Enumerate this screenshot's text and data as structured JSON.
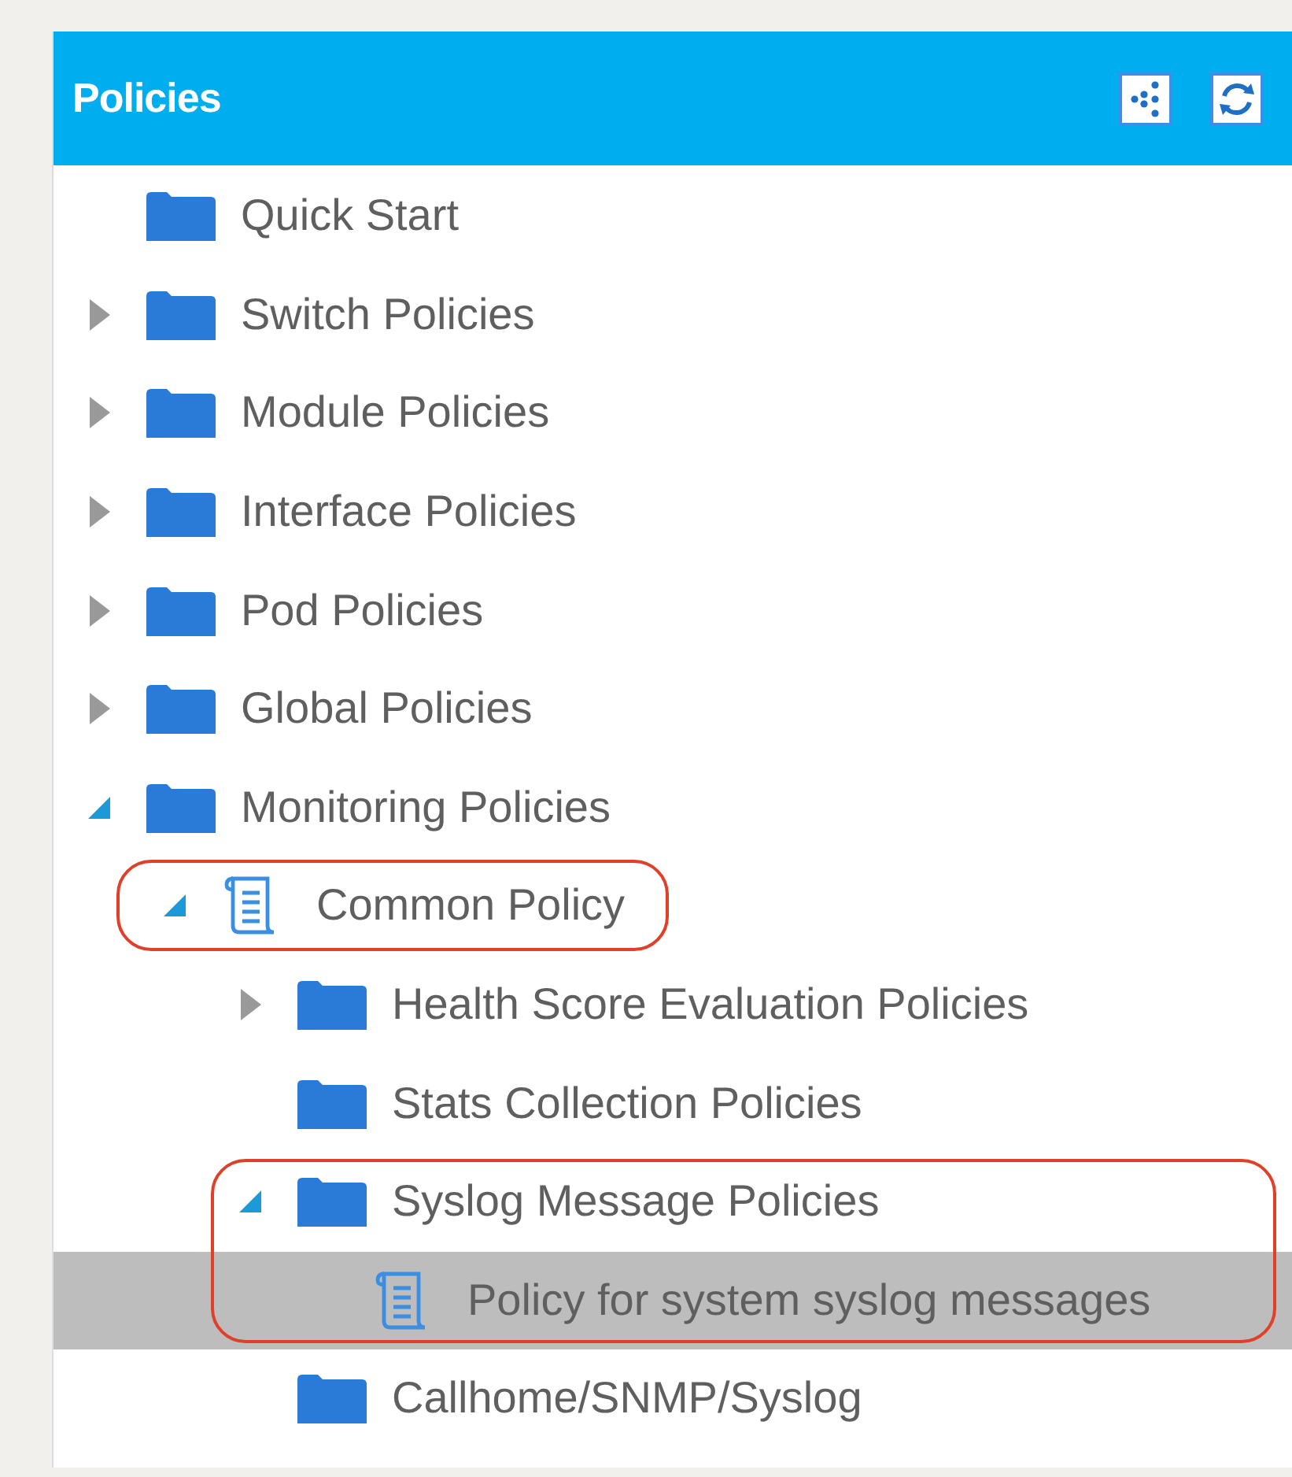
{
  "panel": {
    "title": "Policies"
  },
  "tree": [
    {
      "label": "Quick Start",
      "kind": "folder",
      "selected": false
    },
    {
      "label": "Switch Policies",
      "kind": "folder",
      "expanded": false,
      "selected": false
    },
    {
      "label": "Module Policies",
      "kind": "folder",
      "expanded": false,
      "selected": false
    },
    {
      "label": "Interface Policies",
      "kind": "folder",
      "expanded": false,
      "selected": false
    },
    {
      "label": "Pod Policies",
      "kind": "folder",
      "expanded": false,
      "selected": false
    },
    {
      "label": "Global Policies",
      "kind": "folder",
      "expanded": false,
      "selected": false
    },
    {
      "label": "Monitoring Policies",
      "kind": "folder",
      "expanded": true,
      "selected": false,
      "children": [
        {
          "label": "Common Policy",
          "kind": "policy",
          "expanded": true,
          "selected": false,
          "circled": true,
          "children": [
            {
              "label": "Health Score Evaluation Policies",
              "kind": "folder",
              "expanded": false,
              "selected": false
            },
            {
              "label": "Stats Collection Policies",
              "kind": "folder",
              "selected": false
            },
            {
              "label": "Syslog Message Policies",
              "kind": "folder",
              "expanded": true,
              "selected": false,
              "circled_with_children": true,
              "children": [
                {
                  "label": "Policy for system syslog messages",
                  "kind": "policy",
                  "selected": true
                }
              ]
            },
            {
              "label": "Callhome/SNMP/Syslog",
              "kind": "folder",
              "selected": false
            }
          ]
        }
      ]
    }
  ]
}
